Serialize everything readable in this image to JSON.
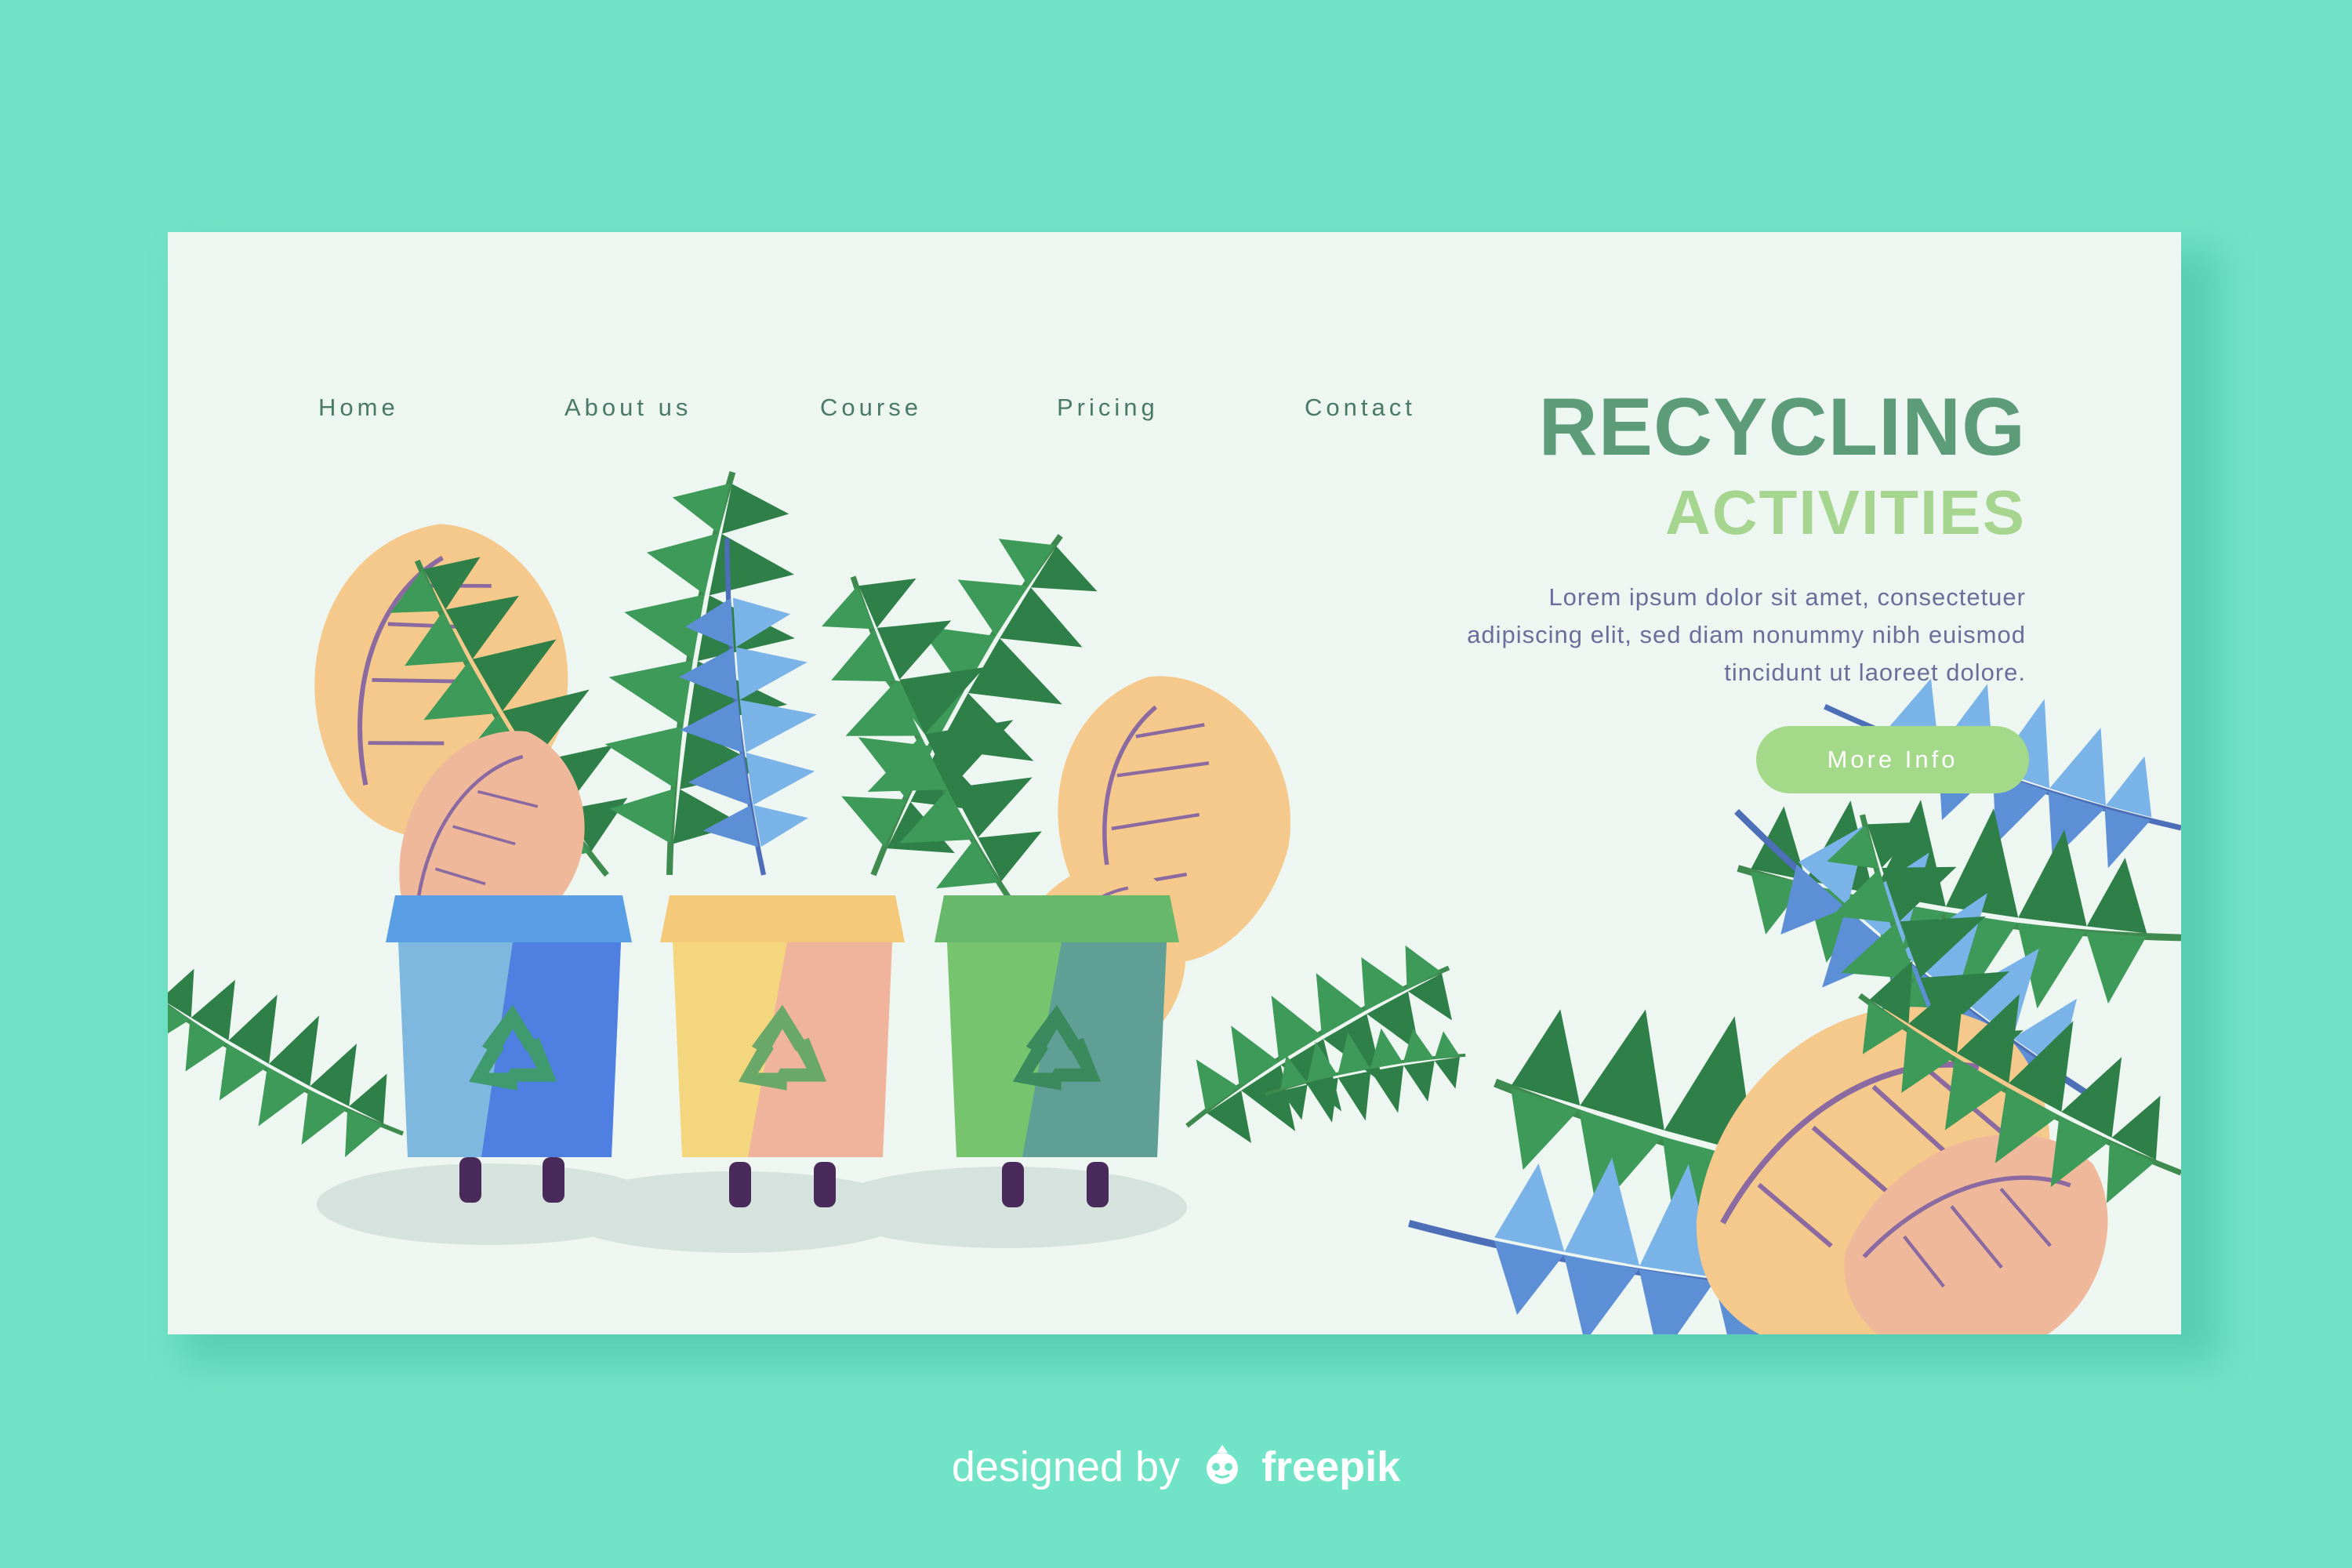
{
  "nav": {
    "items": [
      {
        "label": "Home"
      },
      {
        "label": "About us"
      },
      {
        "label": "Course"
      },
      {
        "label": "Pricing"
      },
      {
        "label": "Contact"
      }
    ]
  },
  "hero": {
    "title_line1": "RECYCLING",
    "title_line2": "ACTIVITIES",
    "description": "Lorem ipsum dolor sit amet, consectetuer adipiscing elit, sed diam nonummy nibh euismod tincidunt ut laoreet dolore.",
    "button_label": "More Info"
  },
  "illustration": {
    "bins": [
      {
        "color": "blue",
        "icon": "recycle-icon"
      },
      {
        "color": "yellow",
        "icon": "recycle-icon"
      },
      {
        "color": "green",
        "icon": "recycle-icon"
      }
    ]
  },
  "footer": {
    "designed_by": "designed by",
    "brand": "freepik"
  },
  "colors": {
    "page_background": "#71e3c6",
    "card_background": "#eef6f2",
    "title_primary": "#5c9c78",
    "title_secondary": "#a6d58f",
    "button": "#a5d98a"
  }
}
